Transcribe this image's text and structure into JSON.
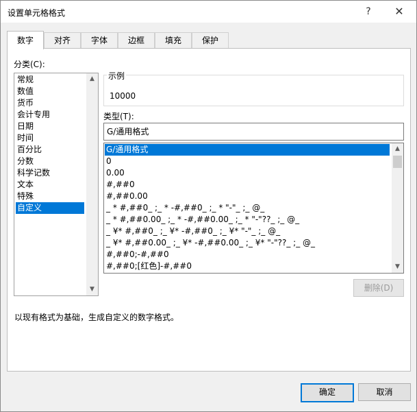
{
  "window": {
    "title": "设置单元格格式",
    "help": "?",
    "close": "✕"
  },
  "tabs": [
    "数字",
    "对齐",
    "字体",
    "边框",
    "填充",
    "保护"
  ],
  "category": {
    "label": "分类(C):",
    "items": [
      "常规",
      "数值",
      "货币",
      "会计专用",
      "日期",
      "时间",
      "百分比",
      "分数",
      "科学记数",
      "文本",
      "特殊",
      "自定义"
    ],
    "selected": "自定义"
  },
  "sample": {
    "legend": "示例",
    "value": "10000"
  },
  "type": {
    "label": "类型(T):",
    "value": "G/通用格式",
    "formats": [
      "G/通用格式",
      "0",
      "0.00",
      "#,##0",
      "#,##0.00",
      "_ * #,##0_ ;_ * -#,##0_ ;_ * \"-\"_ ;_ @_",
      "_ * #,##0.00_ ;_ * -#,##0.00_ ;_ * \"-\"??_ ;_ @_",
      "_ ¥* #,##0_ ;_ ¥* -#,##0_ ;_ ¥* \"-\"_ ;_ @_",
      "_ ¥* #,##0.00_ ;_ ¥* -#,##0.00_ ;_ ¥* \"-\"??_ ;_ @_",
      "#,##0;-#,##0",
      "#,##0;[红色]-#,##0"
    ],
    "selected": "G/通用格式"
  },
  "buttons": {
    "delete": "删除(D)",
    "ok": "确定",
    "cancel": "取消"
  },
  "hint": "以现有格式为基础，生成自定义的数字格式。",
  "icons": {
    "scroll_up": "▲",
    "scroll_down": "▼"
  },
  "colors": {
    "selection": "#0078d7",
    "default_button_border": "#0078d7"
  }
}
